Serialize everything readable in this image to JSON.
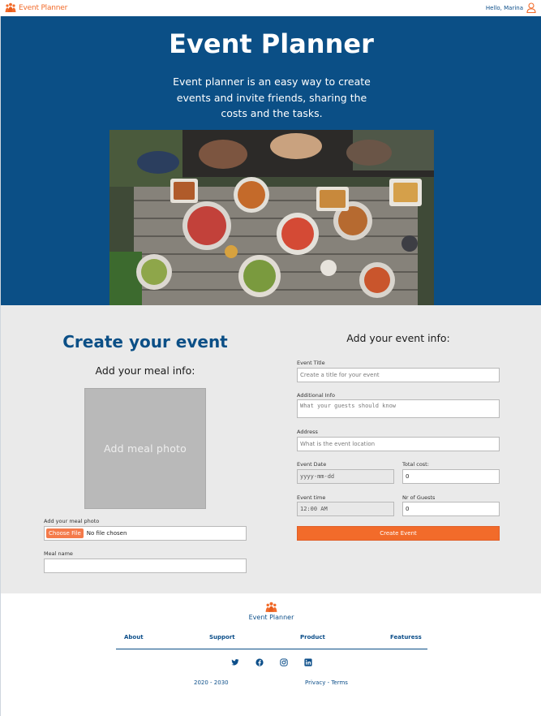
{
  "nav": {
    "brand": "Event Planner",
    "greeting": "Hello, Marina"
  },
  "hero": {
    "title": "Event Planner",
    "description": "Event planner is an easy way to create events and invite friends, sharing the costs and the tasks."
  },
  "create": {
    "title": "Create your event",
    "meal_info_title": "Add your meal info:",
    "photo_placeholder": "Add meal photo",
    "meal_photo_label": "Add your meal photo",
    "file_button": "Choose File",
    "file_status": "No file chosen",
    "meal_name_label": "Meal name",
    "meal_name_value": "",
    "event_info_title": "Add your event info:",
    "event_title_label": "Event Title",
    "event_title_placeholder": "Create a title for your event",
    "additional_info_label": "Additional Info",
    "additional_info_placeholder": "What your guests should know",
    "address_label": "Address",
    "address_placeholder": "What is the event location",
    "event_date_label": "Event Date",
    "event_date_value": "yyyy-mm-dd",
    "total_cost_label": "Total cost:",
    "total_cost_value": "0",
    "event_time_label": "Event time",
    "event_time_value": "12:00 AM",
    "guests_label": "Nr of Guests",
    "guests_value": "0",
    "submit_label": "Create Event"
  },
  "footer": {
    "brand": "Event Planner",
    "links": [
      "About",
      "Support",
      "Product",
      "Featuress"
    ],
    "socials": [
      "twitter-icon",
      "facebook-icon",
      "instagram-icon",
      "linkedin-icon"
    ],
    "copyright": "2020 - 2030",
    "legal": "Privacy - Terms"
  },
  "colors": {
    "primary": "#0b4f86",
    "accent": "#f26b2a",
    "section_bg": "#eaeaea"
  }
}
